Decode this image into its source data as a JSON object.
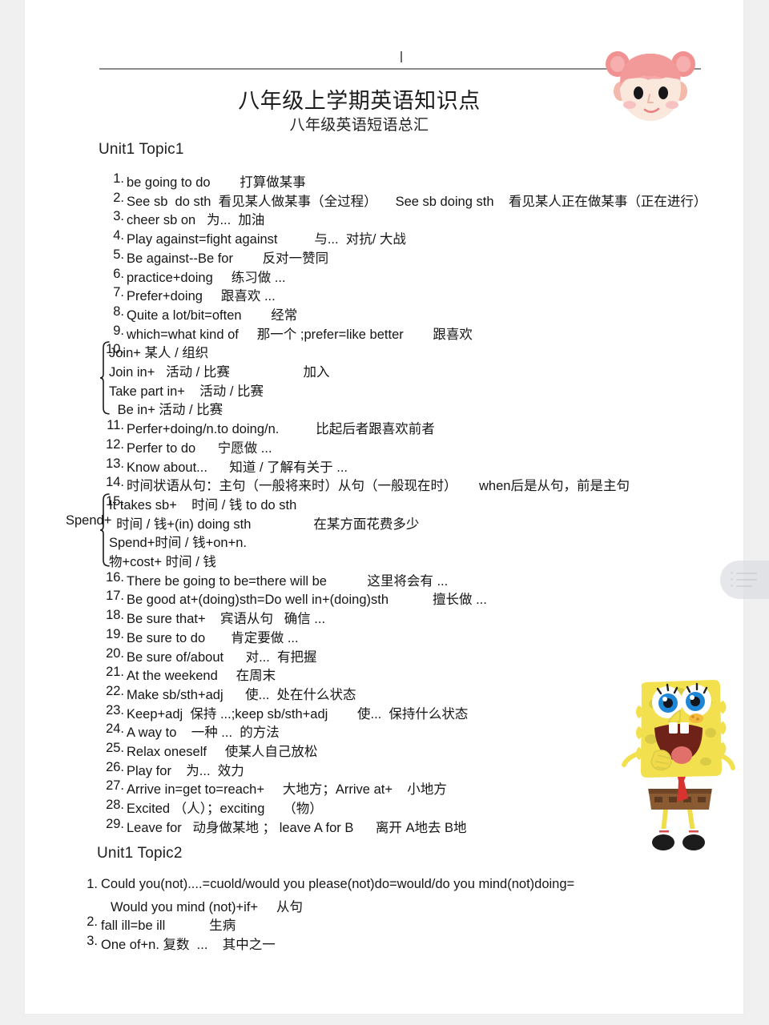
{
  "document": {
    "title": "八年级上学期英语知识点",
    "subtitle": "八年级英语短语总汇"
  },
  "decorations": {
    "avatar_icon": "girl-avatar-pink-buns-icon",
    "character_image": "spongebob-squarepants-image",
    "side_widget_icon": "floating-menu-icon",
    "caret_mark": "text-caret-mark"
  },
  "sections": [
    {
      "heading": "Unit1 Topic1",
      "items": [
        {
          "num": "1.",
          "text": "be going to do        打算做某事"
        },
        {
          "num": "2.",
          "text": "See sb  do sth  看见某人做某事（全过程）     See sb doing sth    看见某人正在做某事（正在进行）"
        },
        {
          "num": "3.",
          "text": "cheer sb on   为...  加油"
        },
        {
          "num": "4.",
          "text": "Play against=fight against          与...  对抗/ 大战"
        },
        {
          "num": "5.",
          "text": "Be against--Be for        反对一赞同"
        },
        {
          "num": "6.",
          "text": "practice+doing     练习做 ..."
        },
        {
          "num": "7.",
          "text": "Prefer+doing     跟喜欢 ..."
        },
        {
          "num": "8.",
          "text": "Quite a lot/bit=often        经常"
        },
        {
          "num": "9.",
          "text": "which=what kind of     那一个 ;prefer=like better        跟喜欢"
        },
        {
          "num": "10.",
          "text": "Join+ 某人 / 组织",
          "brace": true,
          "brace_lines": [
            "Join+ 某人 / 组织",
            "Join in+   活动 / 比赛                    加入",
            "Take part in+    活动 / 比赛",
            " Be in+ 活动 / 比赛"
          ]
        },
        {
          "num": "11.",
          "text": "Perfer+doing/n.to doing/n.          比起后者跟喜欢前者"
        },
        {
          "num": "12.",
          "text": "Perfer to do      宁愿做 ..."
        },
        {
          "num": "13.",
          "text": "Know about...      知道 / 了解有关于 ..."
        },
        {
          "num": "14.",
          "text": "时间状语从句：主句（一般将来时）从句（一般现在时）      when后是从句，前是主句"
        },
        {
          "num": "15.",
          "text": "It takes sb+    时间 / 钱 to do sth",
          "brace": true,
          "brace_prefix": "Spend+",
          "brace_lines": [
            "It takes sb+    时间 / 钱 to do sth",
            "  时间 / 钱+(in) doing sth                 在某方面花费多少",
            "Spend+时间 / 钱+on+n.",
            "物+cost+ 时间 / 钱"
          ]
        },
        {
          "num": "16.",
          "text": "There be going to be=there will be           这里将会有 ..."
        },
        {
          "num": "17.",
          "text": "Be good at+(doing)sth=Do well in+(doing)sth            擅长做 ..."
        },
        {
          "num": "18.",
          "text": "Be sure that+    宾语从句   确信 ..."
        },
        {
          "num": "19.",
          "text": "Be sure to do       肯定要做 ..."
        },
        {
          "num": "20.",
          "text": "Be sure of/about      对...  有把握"
        },
        {
          "num": "21.",
          "text": "At the weekend     在周末"
        },
        {
          "num": "22.",
          "text": "Make sb/sth+adj      使...  处在什么状态"
        },
        {
          "num": "23.",
          "text": "Keep+adj  保持 ...;keep sb/sth+adj        使...  保持什么状态"
        },
        {
          "num": "24.",
          "text": "A way to    一种 ...  的方法"
        },
        {
          "num": "25.",
          "text": "Relax oneself     使某人自己放松"
        },
        {
          "num": "26.",
          "text": "Play for    为...  效力"
        },
        {
          "num": "27.",
          "text": "Arrive in=get to=reach+     大地方；Arrive at+    小地方"
        },
        {
          "num": "28.",
          "text": "Excited （人）；exciting     （物）"
        },
        {
          "num": "29.",
          "text": "Leave for   动身做某地 ； leave A for B      离开 A地去 B地"
        }
      ]
    },
    {
      "heading": "Unit1 Topic2",
      "items": [
        {
          "num": "1.",
          "text": "Could you(not)....=cuold/would you please(not)do=would/do you mind(not)doing=",
          "cont": "Would you mind (not)+if+     从句"
        },
        {
          "num": "2.",
          "text": "fall ill=be ill            生病"
        },
        {
          "num": "3.",
          "text": "One of+n. 复数  ...    其中之一"
        }
      ]
    }
  ],
  "colors": {
    "page_background": "#ffffff",
    "canvas_background": "#f0f0f0",
    "text": "#161616",
    "rule": "#8c8c8c",
    "avatar_hair": "#f5a3a3",
    "avatar_skin": "#fbeadf",
    "sponge_yellow": "#f2e34c"
  }
}
